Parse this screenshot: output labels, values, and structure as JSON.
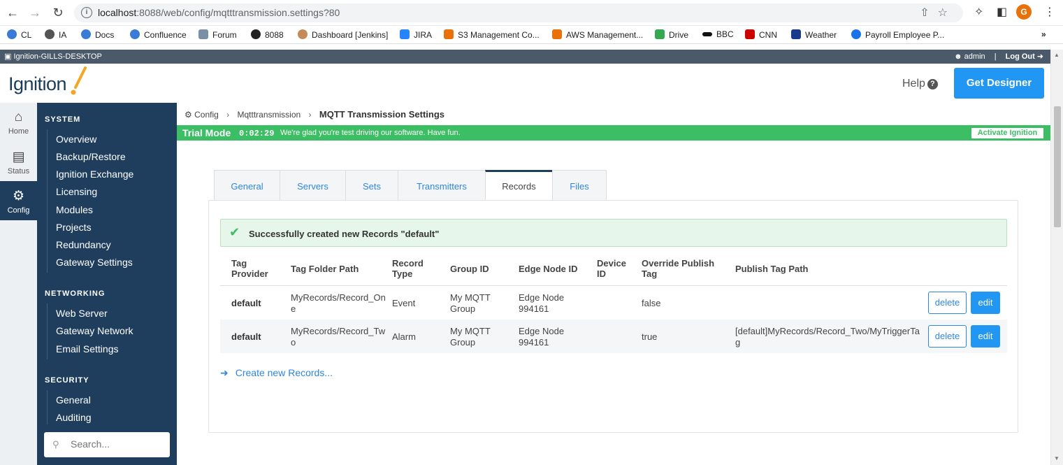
{
  "browser": {
    "url_host": "localhost",
    "url_rest": ":8088/web/config/mqtttransmission.settings?80",
    "avatar_letter": "G",
    "icons": [
      "back-arrow-icon",
      "forward-arrow-icon",
      "reload-icon",
      "info-icon",
      "share-icon",
      "star-icon",
      "puzzle-icon",
      "sidepanel-icon",
      "kebab-menu-icon"
    ]
  },
  "bookmarks": [
    {
      "label": "CL",
      "color": "#3a7bd5"
    },
    {
      "label": "IA",
      "color": "#555555"
    },
    {
      "label": "Docs",
      "color": "#3a7bd5"
    },
    {
      "label": "Confluence",
      "color": "#3a7bd5"
    },
    {
      "label": "Forum",
      "color": "#7a8fa6"
    },
    {
      "label": "8088",
      "color": "#222222"
    },
    {
      "label": "Dashboard [Jenkins]",
      "color": "#c48a5a"
    },
    {
      "label": "JIRA",
      "color": "#2684ff"
    },
    {
      "label": "S3 Management Co...",
      "color": "#e8710a"
    },
    {
      "label": "AWS Management...",
      "color": "#e8710a"
    },
    {
      "label": "Drive",
      "color": "#34a853"
    },
    {
      "label": "BBC",
      "color": "#111111"
    },
    {
      "label": "CNN",
      "color": "#cc0000"
    },
    {
      "label": "Weather",
      "color": "#1a3b8c"
    },
    {
      "label": "Payroll Employee P...",
      "color": "#1a73e8"
    }
  ],
  "gateway": {
    "name": "Ignition-GILLS-DESKTOP",
    "user": "admin",
    "logout": "Log Out"
  },
  "header": {
    "logo": "Ignition",
    "help": "Help",
    "get_designer": "Get Designer"
  },
  "rail": [
    {
      "label": "Home",
      "icon": "home-icon",
      "active": false
    },
    {
      "label": "Status",
      "icon": "bar-chart-icon",
      "active": false
    },
    {
      "label": "Config",
      "icon": "gear-icon",
      "active": true
    }
  ],
  "sidenav": {
    "sections": [
      {
        "title": "SYSTEM",
        "items": [
          "Overview",
          "Backup/Restore",
          "Ignition Exchange",
          "Licensing",
          "Modules",
          "Projects",
          "Redundancy",
          "Gateway Settings"
        ]
      },
      {
        "title": "NETWORKING",
        "items": [
          "Web Server",
          "Gateway Network",
          "Email Settings"
        ]
      },
      {
        "title": "SECURITY",
        "items": [
          "General",
          "Auditing"
        ]
      }
    ],
    "search_placeholder": "Search..."
  },
  "breadcrumb": {
    "root": "Config",
    "parent": "Mqtttransmission",
    "current": "MQTT Transmission Settings"
  },
  "trial": {
    "label": "Trial Mode",
    "timer": "0:02:29",
    "message": "We're glad you're test driving our software. Have fun.",
    "activate": "Activate Ignition"
  },
  "tabs": [
    "General",
    "Servers",
    "Sets",
    "Transmitters",
    "Records",
    "Files"
  ],
  "active_tab": "Records",
  "alert": {
    "message": "Successfully created new Records \"default\""
  },
  "table": {
    "headers": [
      "Tag Provider",
      "Tag Folder Path",
      "Record Type",
      "Group ID",
      "Edge Node ID",
      "Device ID",
      "Override Publish Tag",
      "Publish Tag Path"
    ],
    "rows": [
      {
        "provider": "default",
        "folder": "MyRecords/Record_One",
        "type": "Event",
        "group": "My MQTT Group",
        "edge": "Edge Node 994161",
        "device": "",
        "override": "false",
        "publish_path": ""
      },
      {
        "provider": "default",
        "folder": "MyRecords/Record_Two",
        "type": "Alarm",
        "group": "My MQTT Group",
        "edge": "Edge Node 994161",
        "device": "",
        "override": "true",
        "publish_path": "[default]MyRecords/Record_Two/MyTriggerTag"
      }
    ],
    "delete_label": "delete",
    "edit_label": "edit"
  },
  "create_link": "Create new Records...",
  "colors": {
    "nav_bg": "#1f3e5e",
    "accent": "#2196f3",
    "trial_green": "#3cbf64"
  }
}
